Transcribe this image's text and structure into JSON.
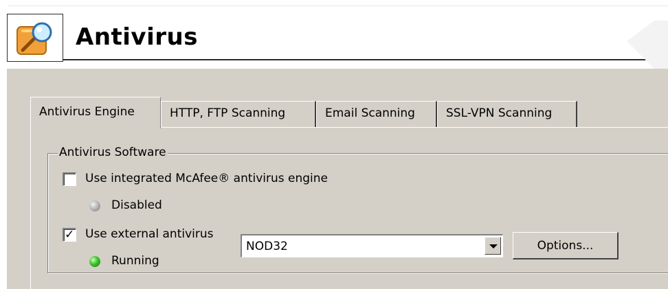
{
  "header": {
    "title": "Antivirus",
    "icon": "antivirus-search-icon"
  },
  "tabs": [
    {
      "label": "Antivirus Engine",
      "active": true
    },
    {
      "label": "HTTP, FTP Scanning",
      "active": false
    },
    {
      "label": "Email Scanning",
      "active": false
    },
    {
      "label": "SSL-VPN Scanning",
      "active": false
    }
  ],
  "group": {
    "legend": "Antivirus Software",
    "integrated": {
      "label": "Use integrated McAfee® antivirus engine",
      "checked": false,
      "status_label": "Disabled",
      "status_color": "#9a9a9a"
    },
    "external": {
      "label": "Use external antivirus",
      "checked": true,
      "selected_value": "NOD32",
      "options_button": "Options...",
      "status_label": "Running",
      "status_color": "#2fa81e"
    }
  },
  "colors": {
    "panel_bg": "#d4d0c8"
  }
}
